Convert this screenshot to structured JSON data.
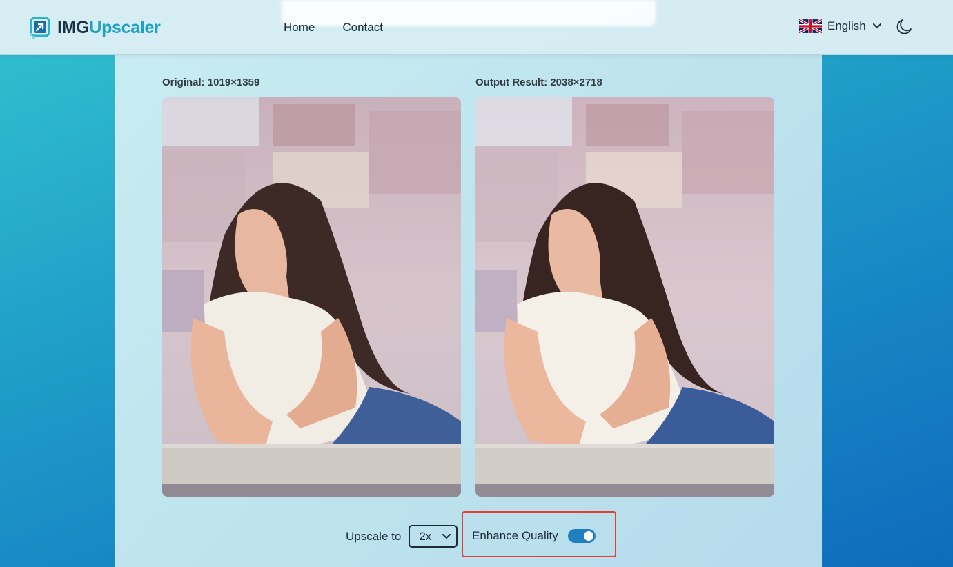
{
  "header": {
    "logo": {
      "text_dark": "IMG",
      "text_accent": "Upscaler",
      "icon": "upscale-arrow-icon"
    },
    "nav": [
      {
        "label": "Home"
      },
      {
        "label": "Contact"
      }
    ],
    "language": {
      "label": "English",
      "flag": "uk-flag-icon"
    },
    "theme_toggle": {
      "icon": "moon-icon"
    }
  },
  "comparison": {
    "original_label": "Original: 1019×1359",
    "output_label": "Output Result: 2038×2718"
  },
  "controls": {
    "upscale_label": "Upscale to",
    "upscale_value": "2x",
    "enhance_label": "Enhance Quality",
    "enhance_enabled": true
  },
  "colors": {
    "brand_dark": "#19324a",
    "brand_accent": "#1ea1c7",
    "toggle_on": "#1f7fbf",
    "highlight_border": "#e53d30"
  }
}
